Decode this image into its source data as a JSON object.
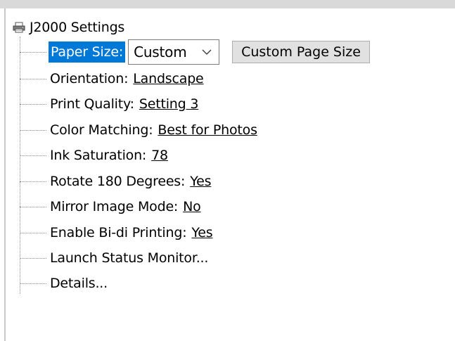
{
  "tree": {
    "root_label": "J2000 Settings",
    "paper_size": {
      "label": "Paper Size:",
      "value": "Custom",
      "button_label": "Custom Page Size"
    },
    "items": [
      {
        "label": "Orientation:",
        "value": "Landscape"
      },
      {
        "label": "Print Quality:",
        "value": "Setting 3"
      },
      {
        "label": "Color Matching:",
        "value": "Best for Photos"
      },
      {
        "label": "Ink Saturation:",
        "value": "78"
      },
      {
        "label": "Rotate 180 Degrees:",
        "value": "Yes"
      },
      {
        "label": "Mirror Image Mode:",
        "value": "No"
      },
      {
        "label": "Enable Bi-di Printing:",
        "value": "Yes"
      }
    ],
    "actions": [
      {
        "label": "Launch Status Monitor..."
      },
      {
        "label": "Details..."
      }
    ]
  },
  "colors": {
    "selection": "#0078d7",
    "button_face": "#e1e1e1"
  },
  "icons": {
    "root": "printer-icon",
    "combo": "chevron-down-icon"
  }
}
